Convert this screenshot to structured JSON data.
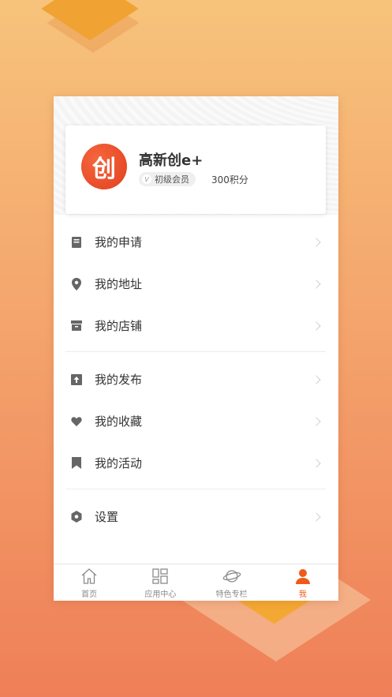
{
  "profile": {
    "avatar_text": "创",
    "name": "高新创e+",
    "badge_icon": "V",
    "member_level": "初级会员",
    "points": "300积分"
  },
  "menu_groups": [
    {
      "items": [
        {
          "label": "我的申请",
          "icon": "document-icon"
        },
        {
          "label": "我的地址",
          "icon": "location-pin-icon"
        },
        {
          "label": "我的店铺",
          "icon": "store-icon"
        }
      ]
    },
    {
      "items": [
        {
          "label": "我的发布",
          "icon": "upload-icon"
        },
        {
          "label": "我的收藏",
          "icon": "heart-icon"
        },
        {
          "label": "我的活动",
          "icon": "bookmark-icon"
        }
      ]
    },
    {
      "items": [
        {
          "label": "设置",
          "icon": "settings-hexagon-icon"
        }
      ]
    }
  ],
  "tabbar": {
    "tabs": [
      {
        "label": "首页",
        "icon": "home-icon"
      },
      {
        "label": "应用中心",
        "icon": "grid-icon"
      },
      {
        "label": "特色专栏",
        "icon": "planet-icon"
      },
      {
        "label": "我",
        "icon": "person-icon",
        "active": true
      }
    ]
  },
  "colors": {
    "accent": "#ee5a1c",
    "icon_gray": "#666666",
    "avatar_red": "#e2401f"
  }
}
